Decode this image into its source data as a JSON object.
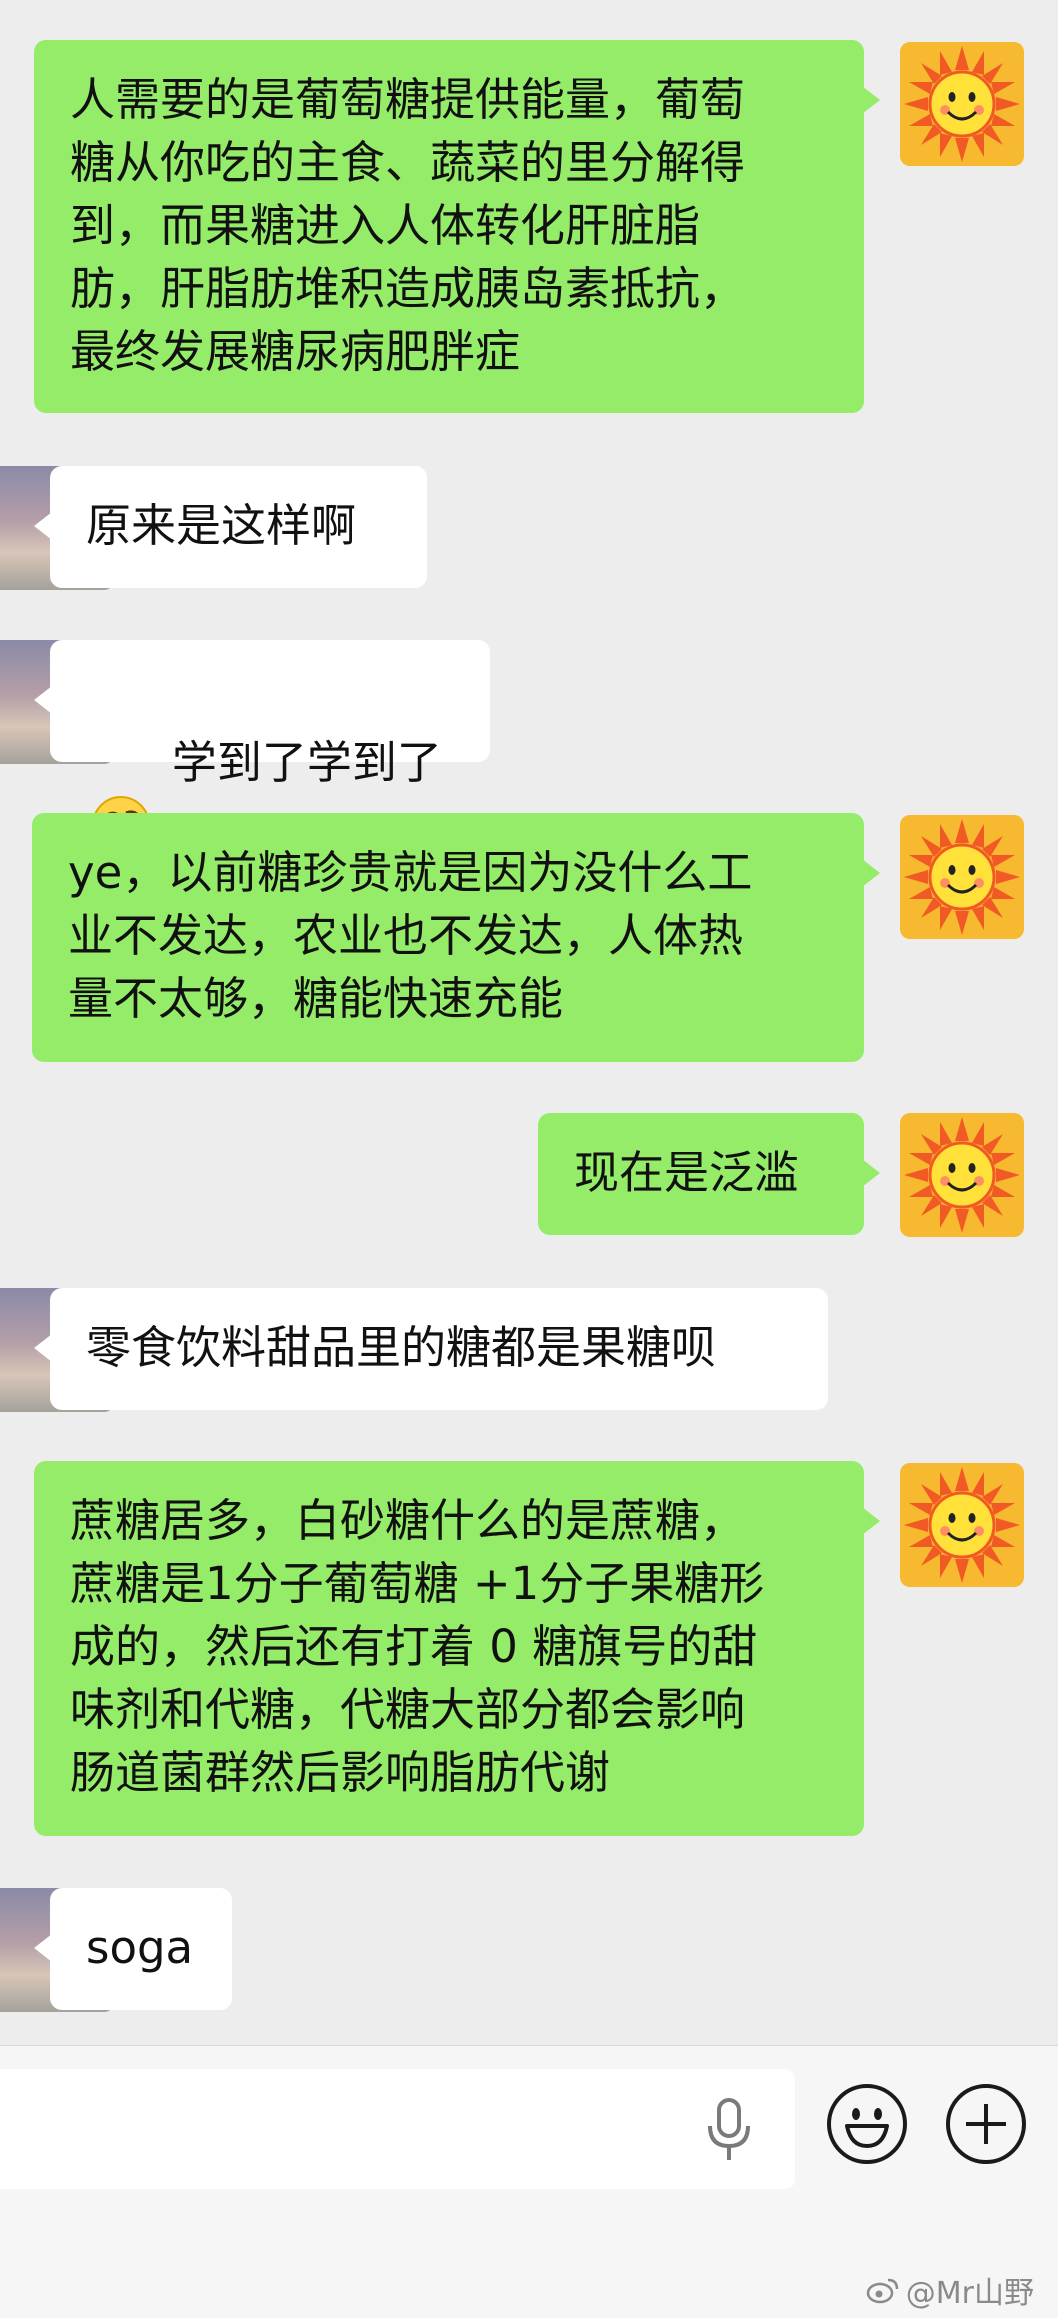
{
  "messages": [
    {
      "side": "me",
      "text": "人需要的是葡萄糖提供能量，葡萄\n糖从你吃的主食、蔬菜的里分解得\n到，而果糖进入人体转化肝脏脂\n肪，肝脂肪堆积造成胰岛素抵抗，\n最终发展糖尿病肥胖症"
    },
    {
      "side": "other",
      "text": "原来是这样啊"
    },
    {
      "side": "other",
      "text": "学到了学到了",
      "emoji": "thinking-face-icon"
    },
    {
      "side": "me",
      "text": "ye，以前糖珍贵就是因为没什么工\n业不发达，农业也不发达，人体热\n量不太够，糖能快速充能"
    },
    {
      "side": "me",
      "text": "现在是泛滥"
    },
    {
      "side": "other",
      "text": "零食饮料甜品里的糖都是果糖呗"
    },
    {
      "side": "me",
      "text": "蔗糖居多，白砂糖什么的是蔗糖，\n蔗糖是1分子葡萄糖 +1分子果糖形\n成的，然后还有打着 0 糖旗号的甜\n味剂和代糖，代糖大部分都会影响\n肠道菌群然后影响脂肪代谢"
    },
    {
      "side": "other",
      "text": "soga"
    }
  ],
  "input": {
    "value": "",
    "placeholder": ""
  },
  "watermark": {
    "text": "@Mr山野",
    "icon": "weibo-icon"
  },
  "colors": {
    "my_bubble": "#95ec69",
    "other_bubble": "#ffffff",
    "background": "#ededed"
  }
}
